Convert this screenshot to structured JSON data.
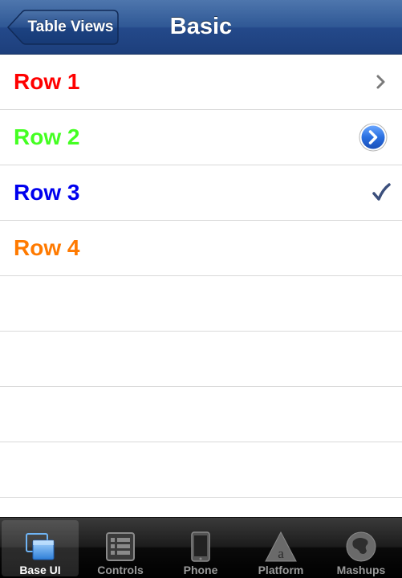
{
  "navbar": {
    "back_label": "Table Views",
    "title": "Basic"
  },
  "rows": [
    {
      "label": "Row 1",
      "color": "#ff0000",
      "accessory": "chevron-icon"
    },
    {
      "label": "Row 2",
      "color": "#44ff22",
      "accessory": "detail-disclosure-icon"
    },
    {
      "label": "Row 3",
      "color": "#0000ee",
      "accessory": "checkmark-icon"
    },
    {
      "label": "Row 4",
      "color": "#ff7a00",
      "accessory": ""
    }
  ],
  "tabbar": {
    "tabs": [
      {
        "label": "Base UI",
        "icon": "windows-icon",
        "selected": true
      },
      {
        "label": "Controls",
        "icon": "list-icon",
        "selected": false
      },
      {
        "label": "Phone",
        "icon": "phone-icon",
        "selected": false
      },
      {
        "label": "Platform",
        "icon": "platform-icon",
        "selected": false
      },
      {
        "label": "Mashups",
        "icon": "mashups-icon",
        "selected": false
      }
    ]
  },
  "colors": {
    "navbar": "#2f5895",
    "tabbar": "#1c1c1c",
    "selected_tab_icon": "#5aa8f0"
  }
}
